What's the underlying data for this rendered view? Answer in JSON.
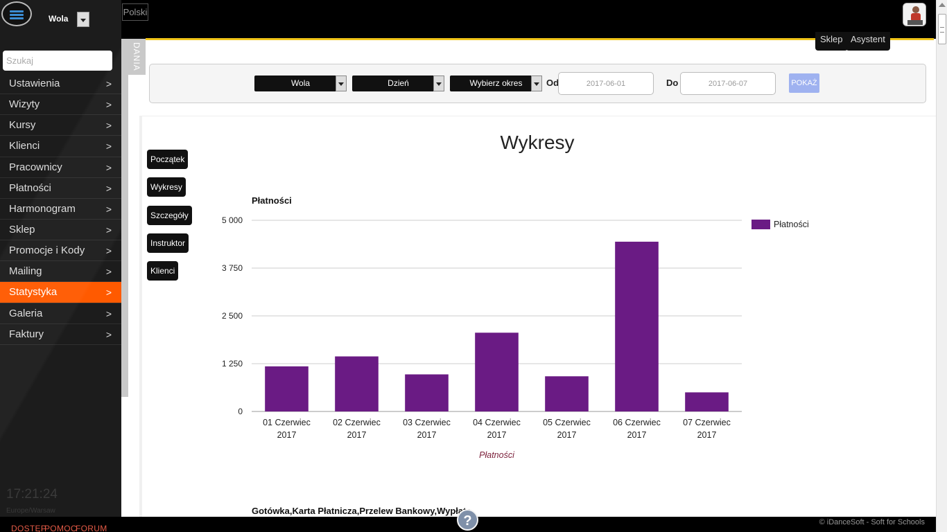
{
  "header": {
    "location": "Wola",
    "language": "Polski",
    "top_buttons": [
      "Sklep",
      "Asystent"
    ],
    "side_tab": "DANIA"
  },
  "sidebar": {
    "search_placeholder": "Szukaj",
    "items": [
      {
        "label": "Ustawienia",
        "arrow": ">"
      },
      {
        "label": "Wizyty",
        "arrow": ">"
      },
      {
        "label": "Kursy",
        "arrow": ">"
      },
      {
        "label": "Klienci",
        "arrow": ">"
      },
      {
        "label": "Pracownicy",
        "arrow": ">"
      },
      {
        "label": "Płatności",
        "arrow": ">"
      },
      {
        "label": "Harmonogram",
        "arrow": ">"
      },
      {
        "label": "Sklep",
        "arrow": ">"
      },
      {
        "label": "Promocje i Kody",
        "arrow": ">"
      },
      {
        "label": "Mailing",
        "arrow": ">"
      },
      {
        "label": "Statystyka",
        "arrow": ">",
        "active": true
      },
      {
        "label": "Galeria",
        "arrow": ">"
      },
      {
        "label": "Faktury",
        "arrow": ">"
      }
    ],
    "clock": "17:21:24",
    "timezone": "Europe/Warsaw"
  },
  "filters": {
    "location": "Wola",
    "granularity": "Dzień",
    "period": "Wybierz okres",
    "from_label": "Od",
    "from_value": "2017-06-01",
    "to_label": "Do",
    "to_value": "2017-06-07",
    "show_label": "POKAŻ"
  },
  "main": {
    "title": "Wykresy",
    "nav_buttons": [
      "Początek",
      "Wykresy",
      "Szczegóły",
      "Instruktor",
      "Klienci"
    ],
    "chart_title": "Płatności",
    "chart2_title": "Gotówka,Karta Płatnicza,Przelew Bankowy,Wypłata"
  },
  "footer": {
    "links": [
      "DOSTĘP",
      "POMOC",
      "FORUM"
    ],
    "copyright": "© iDanceSoft - Soft for Schools",
    "help": "?"
  },
  "chart_data": {
    "type": "bar",
    "title": "Płatności",
    "categories": [
      [
        "01 Czerwiec",
        "2017"
      ],
      [
        "02 Czerwiec",
        "2017"
      ],
      [
        "03 Czerwiec",
        "2017"
      ],
      [
        "04 Czerwiec",
        "2017"
      ],
      [
        "05 Czerwiec",
        "2017"
      ],
      [
        "06 Czerwiec",
        "2017"
      ],
      [
        "07 Czerwiec",
        "2017"
      ]
    ],
    "series": [
      {
        "name": "Płatności",
        "values": [
          1180,
          1440,
          970,
          2060,
          920,
          4440,
          500
        ],
        "color": "#6a1b84"
      }
    ],
    "xlabel": "Płatności",
    "ylabel": "",
    "ylim": [
      0,
      5000
    ],
    "yticks": [
      0,
      1250,
      2500,
      3750,
      5000
    ],
    "ytick_labels": [
      "0",
      "1 250",
      "2 500",
      "3 750",
      "5 000"
    ],
    "grid": true,
    "legend": "right"
  }
}
